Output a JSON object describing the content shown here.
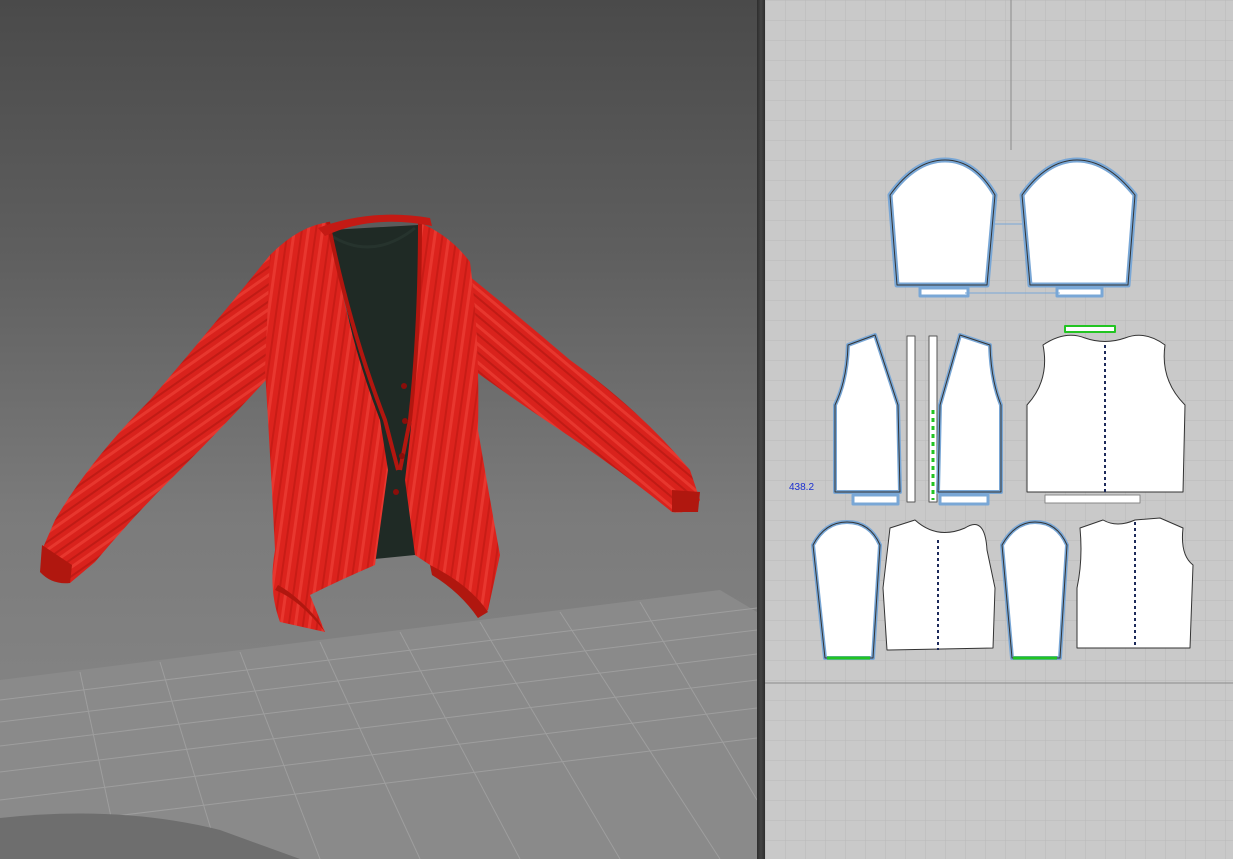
{
  "viewport": {
    "background_top": "#4a4a4a",
    "background_bottom": "#8a8a8a",
    "garment_color": "#d8221c",
    "inner_shirt_color": "#1f2a25"
  },
  "pattern_window": {
    "background": "#c9c9c9",
    "grid_color": "#b7b7b7",
    "seam_color": "#79a7d6",
    "measurement_label": "438.2"
  }
}
